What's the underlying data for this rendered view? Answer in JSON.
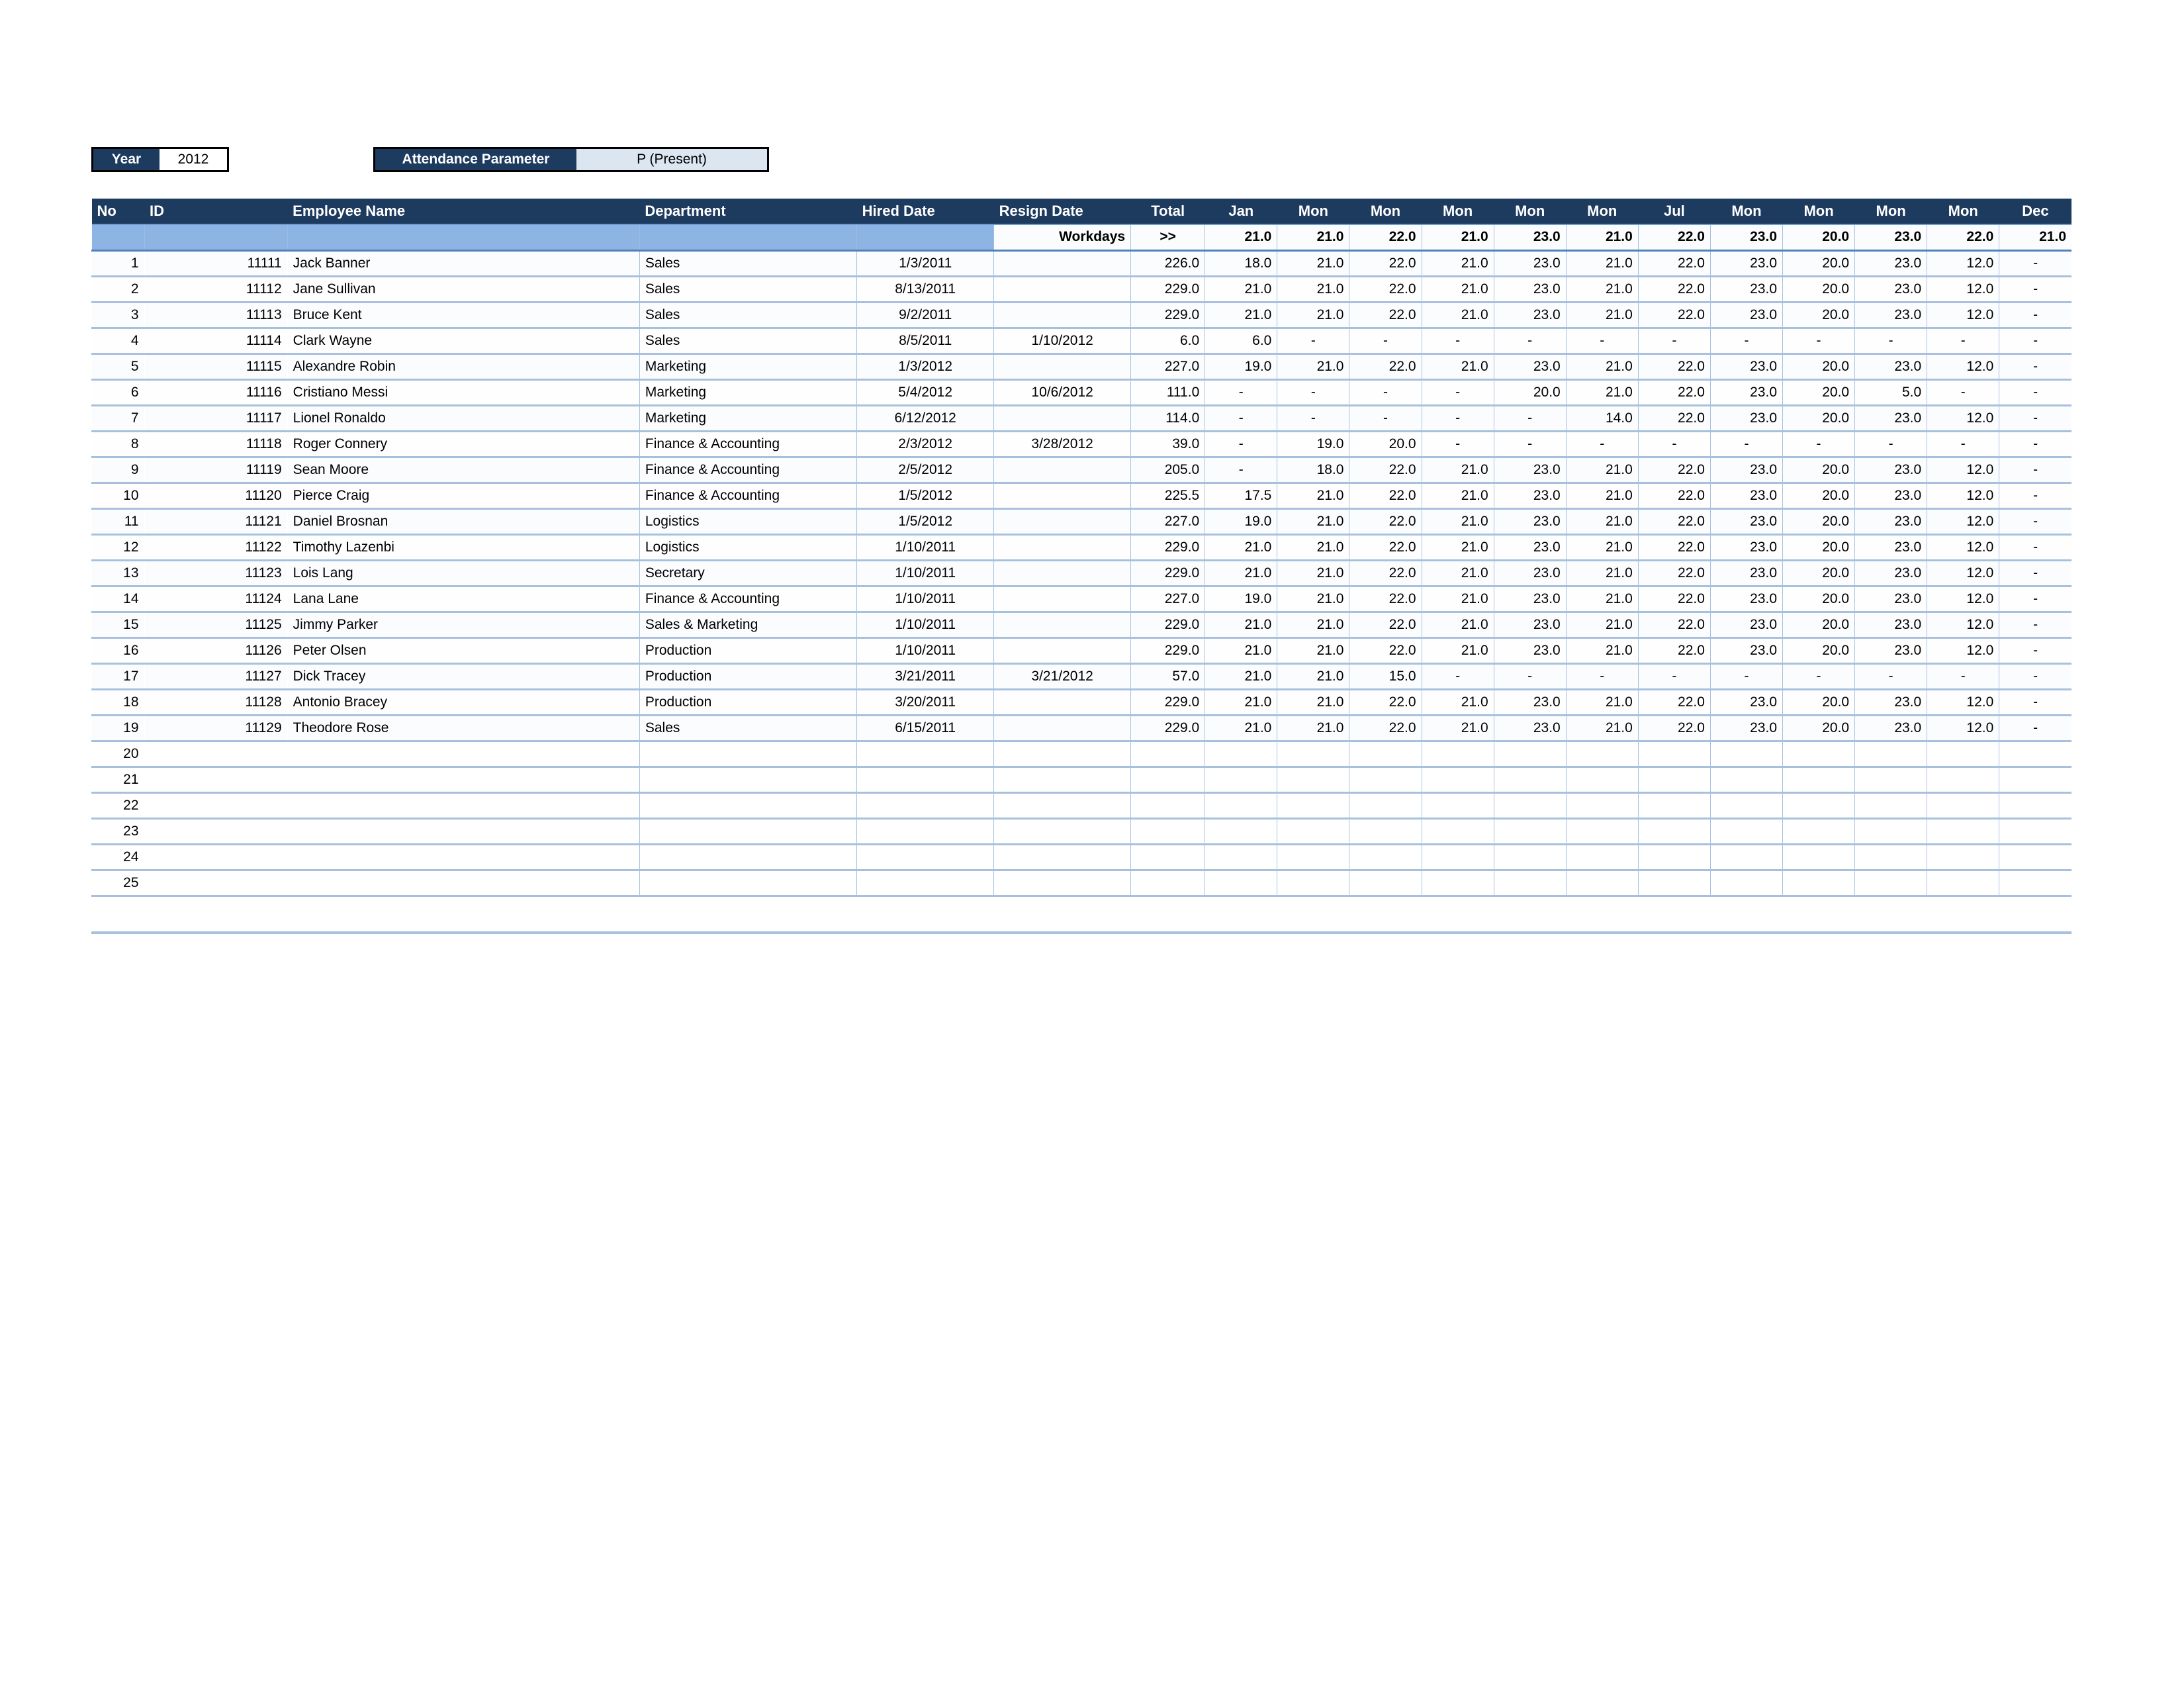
{
  "params": {
    "year": {
      "label": "Year",
      "value": "2012"
    },
    "attendance": {
      "label": "Attendance Parameter",
      "value": "P (Present)"
    }
  },
  "colors": {
    "header_navy": "#1D3A5F",
    "band_blue": "#8DB4E2",
    "value_fill": "#DCE6F1",
    "grid_blue": "#A7C0DE"
  },
  "table": {
    "headers": {
      "no": "No",
      "id": "ID",
      "name": "Employee Name",
      "department": "Department",
      "hired_date": "Hired Date",
      "resign_date": "Resign Date",
      "total": "Total",
      "months": [
        "Jan",
        "Mon",
        "Mon",
        "Mon",
        "Mon",
        "Mon",
        "Jul",
        "Mon",
        "Mon",
        "Mon",
        "Mon",
        "Dec"
      ]
    },
    "workdays": {
      "label": "Workdays",
      "total": ">>",
      "values": [
        "21.0",
        "21.0",
        "22.0",
        "21.0",
        "23.0",
        "21.0",
        "22.0",
        "23.0",
        "20.0",
        "23.0",
        "22.0",
        "21.0"
      ]
    },
    "rows": [
      {
        "no": "1",
        "id": "11111",
        "name": "Jack Banner",
        "department": "Sales",
        "hired": "1/3/2011",
        "resign": "",
        "total": "226.0",
        "months": [
          "18.0",
          "21.0",
          "22.0",
          "21.0",
          "23.0",
          "21.0",
          "22.0",
          "23.0",
          "20.0",
          "23.0",
          "12.0",
          "-"
        ]
      },
      {
        "no": "2",
        "id": "11112",
        "name": "Jane Sullivan",
        "department": "Sales",
        "hired": "8/13/2011",
        "resign": "",
        "total": "229.0",
        "months": [
          "21.0",
          "21.0",
          "22.0",
          "21.0",
          "23.0",
          "21.0",
          "22.0",
          "23.0",
          "20.0",
          "23.0",
          "12.0",
          "-"
        ]
      },
      {
        "no": "3",
        "id": "11113",
        "name": "Bruce Kent",
        "department": "Sales",
        "hired": "9/2/2011",
        "resign": "",
        "total": "229.0",
        "months": [
          "21.0",
          "21.0",
          "22.0",
          "21.0",
          "23.0",
          "21.0",
          "22.0",
          "23.0",
          "20.0",
          "23.0",
          "12.0",
          "-"
        ]
      },
      {
        "no": "4",
        "id": "11114",
        "name": "Clark Wayne",
        "department": "Sales",
        "hired": "8/5/2011",
        "resign": "1/10/2012",
        "total": "6.0",
        "months": [
          "6.0",
          "-",
          "-",
          "-",
          "-",
          "-",
          "-",
          "-",
          "-",
          "-",
          "-",
          "-"
        ]
      },
      {
        "no": "5",
        "id": "11115",
        "name": "Alexandre Robin",
        "department": "Marketing",
        "hired": "1/3/2012",
        "resign": "",
        "total": "227.0",
        "months": [
          "19.0",
          "21.0",
          "22.0",
          "21.0",
          "23.0",
          "21.0",
          "22.0",
          "23.0",
          "20.0",
          "23.0",
          "12.0",
          "-"
        ]
      },
      {
        "no": "6",
        "id": "11116",
        "name": "Cristiano Messi",
        "department": "Marketing",
        "hired": "5/4/2012",
        "resign": "10/6/2012",
        "total": "111.0",
        "months": [
          "-",
          "-",
          "-",
          "-",
          "20.0",
          "21.0",
          "22.0",
          "23.0",
          "20.0",
          "5.0",
          "-",
          "-"
        ]
      },
      {
        "no": "7",
        "id": "11117",
        "name": "Lionel Ronaldo",
        "department": "Marketing",
        "hired": "6/12/2012",
        "resign": "",
        "total": "114.0",
        "months": [
          "-",
          "-",
          "-",
          "-",
          "-",
          "14.0",
          "22.0",
          "23.0",
          "20.0",
          "23.0",
          "12.0",
          "-"
        ]
      },
      {
        "no": "8",
        "id": "11118",
        "name": "Roger Connery",
        "department": "Finance & Accounting",
        "hired": "2/3/2012",
        "resign": "3/28/2012",
        "total": "39.0",
        "months": [
          "-",
          "19.0",
          "20.0",
          "-",
          "-",
          "-",
          "-",
          "-",
          "-",
          "-",
          "-",
          "-"
        ]
      },
      {
        "no": "9",
        "id": "11119",
        "name": "Sean Moore",
        "department": "Finance & Accounting",
        "hired": "2/5/2012",
        "resign": "",
        "total": "205.0",
        "months": [
          "-",
          "18.0",
          "22.0",
          "21.0",
          "23.0",
          "21.0",
          "22.0",
          "23.0",
          "20.0",
          "23.0",
          "12.0",
          "-"
        ]
      },
      {
        "no": "10",
        "id": "11120",
        "name": "Pierce Craig",
        "department": "Finance & Accounting",
        "hired": "1/5/2012",
        "resign": "",
        "total": "225.5",
        "months": [
          "17.5",
          "21.0",
          "22.0",
          "21.0",
          "23.0",
          "21.0",
          "22.0",
          "23.0",
          "20.0",
          "23.0",
          "12.0",
          "-"
        ]
      },
      {
        "no": "11",
        "id": "11121",
        "name": "Daniel Brosnan",
        "department": "Logistics",
        "hired": "1/5/2012",
        "resign": "",
        "total": "227.0",
        "months": [
          "19.0",
          "21.0",
          "22.0",
          "21.0",
          "23.0",
          "21.0",
          "22.0",
          "23.0",
          "20.0",
          "23.0",
          "12.0",
          "-"
        ]
      },
      {
        "no": "12",
        "id": "11122",
        "name": "Timothy Lazenbi",
        "department": "Logistics",
        "hired": "1/10/2011",
        "resign": "",
        "total": "229.0",
        "months": [
          "21.0",
          "21.0",
          "22.0",
          "21.0",
          "23.0",
          "21.0",
          "22.0",
          "23.0",
          "20.0",
          "23.0",
          "12.0",
          "-"
        ]
      },
      {
        "no": "13",
        "id": "11123",
        "name": "Lois Lang",
        "department": "Secretary",
        "hired": "1/10/2011",
        "resign": "",
        "total": "229.0",
        "months": [
          "21.0",
          "21.0",
          "22.0",
          "21.0",
          "23.0",
          "21.0",
          "22.0",
          "23.0",
          "20.0",
          "23.0",
          "12.0",
          "-"
        ]
      },
      {
        "no": "14",
        "id": "11124",
        "name": "Lana Lane",
        "department": "Finance & Accounting",
        "hired": "1/10/2011",
        "resign": "",
        "total": "227.0",
        "months": [
          "19.0",
          "21.0",
          "22.0",
          "21.0",
          "23.0",
          "21.0",
          "22.0",
          "23.0",
          "20.0",
          "23.0",
          "12.0",
          "-"
        ]
      },
      {
        "no": "15",
        "id": "11125",
        "name": "Jimmy Parker",
        "department": "Sales & Marketing",
        "hired": "1/10/2011",
        "resign": "",
        "total": "229.0",
        "months": [
          "21.0",
          "21.0",
          "22.0",
          "21.0",
          "23.0",
          "21.0",
          "22.0",
          "23.0",
          "20.0",
          "23.0",
          "12.0",
          "-"
        ]
      },
      {
        "no": "16",
        "id": "11126",
        "name": "Peter Olsen",
        "department": "Production",
        "hired": "1/10/2011",
        "resign": "",
        "total": "229.0",
        "months": [
          "21.0",
          "21.0",
          "22.0",
          "21.0",
          "23.0",
          "21.0",
          "22.0",
          "23.0",
          "20.0",
          "23.0",
          "12.0",
          "-"
        ]
      },
      {
        "no": "17",
        "id": "11127",
        "name": "Dick Tracey",
        "department": "Production",
        "hired": "3/21/2011",
        "resign": "3/21/2012",
        "total": "57.0",
        "months": [
          "21.0",
          "21.0",
          "15.0",
          "-",
          "-",
          "-",
          "-",
          "-",
          "-",
          "-",
          "-",
          "-"
        ]
      },
      {
        "no": "18",
        "id": "11128",
        "name": "Antonio Bracey",
        "department": "Production",
        "hired": "3/20/2011",
        "resign": "",
        "total": "229.0",
        "months": [
          "21.0",
          "21.0",
          "22.0",
          "21.0",
          "23.0",
          "21.0",
          "22.0",
          "23.0",
          "20.0",
          "23.0",
          "12.0",
          "-"
        ]
      },
      {
        "no": "19",
        "id": "11129",
        "name": "Theodore Rose",
        "department": "Sales",
        "hired": "6/15/2011",
        "resign": "",
        "total": "229.0",
        "months": [
          "21.0",
          "21.0",
          "22.0",
          "21.0",
          "23.0",
          "21.0",
          "22.0",
          "23.0",
          "20.0",
          "23.0",
          "12.0",
          "-"
        ]
      }
    ],
    "empty_rows": [
      {
        "no": "20"
      },
      {
        "no": "21"
      },
      {
        "no": "22"
      },
      {
        "no": "23"
      },
      {
        "no": "24"
      },
      {
        "no": "25"
      }
    ]
  }
}
